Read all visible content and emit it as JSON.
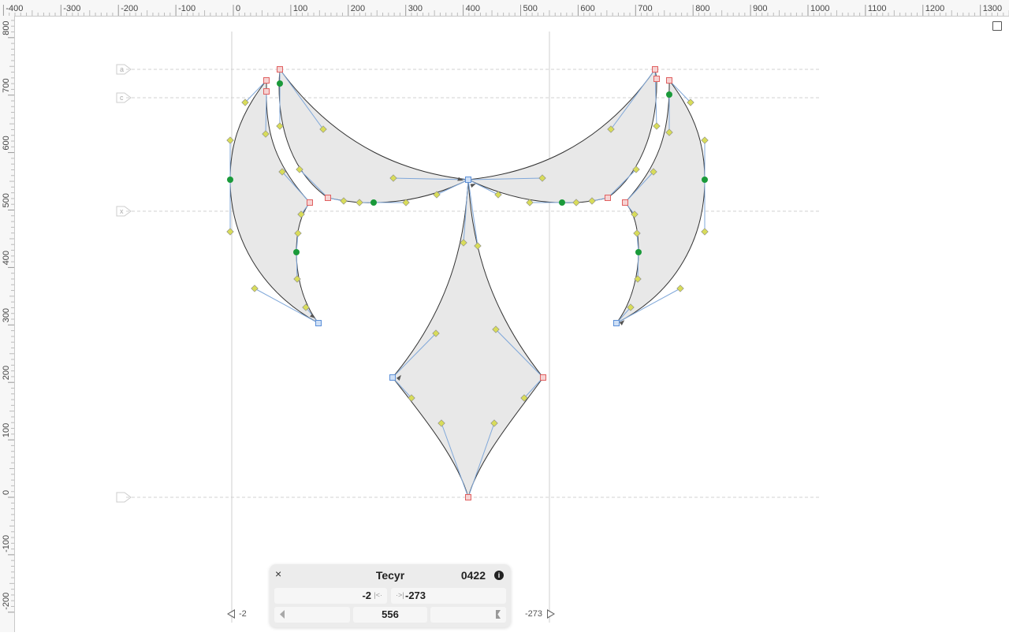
{
  "rulers": {
    "horizontal_labels": [
      "-400",
      "-300",
      "-200",
      "-100",
      "0",
      "100",
      "200",
      "300",
      "400",
      "500",
      "600",
      "700",
      "800",
      "900",
      "1000",
      "1100",
      "1200",
      "1300"
    ],
    "vertical_labels": [
      "800",
      "700",
      "600",
      "500",
      "400",
      "300",
      "200",
      "100",
      "0",
      "-100",
      "-200"
    ]
  },
  "guidelines": {
    "labels": [
      "a",
      "c",
      "x",
      ""
    ]
  },
  "glyph": {
    "name": "Tecyr",
    "unicode": "0422",
    "lsb": "-2",
    "rsb": "-273",
    "width": "556"
  },
  "sidebearing_markers": {
    "left_label": "-2",
    "right_label": "-273"
  },
  "colors": {
    "on_curve_corner": "#e06060",
    "on_curve_selected": "#5b8fd8",
    "on_curve_smooth": "#1a9a3a",
    "off_curve": "#d8dc5a",
    "fill": "#e8e8e8"
  },
  "icons": {
    "close": "×",
    "info": "i"
  }
}
